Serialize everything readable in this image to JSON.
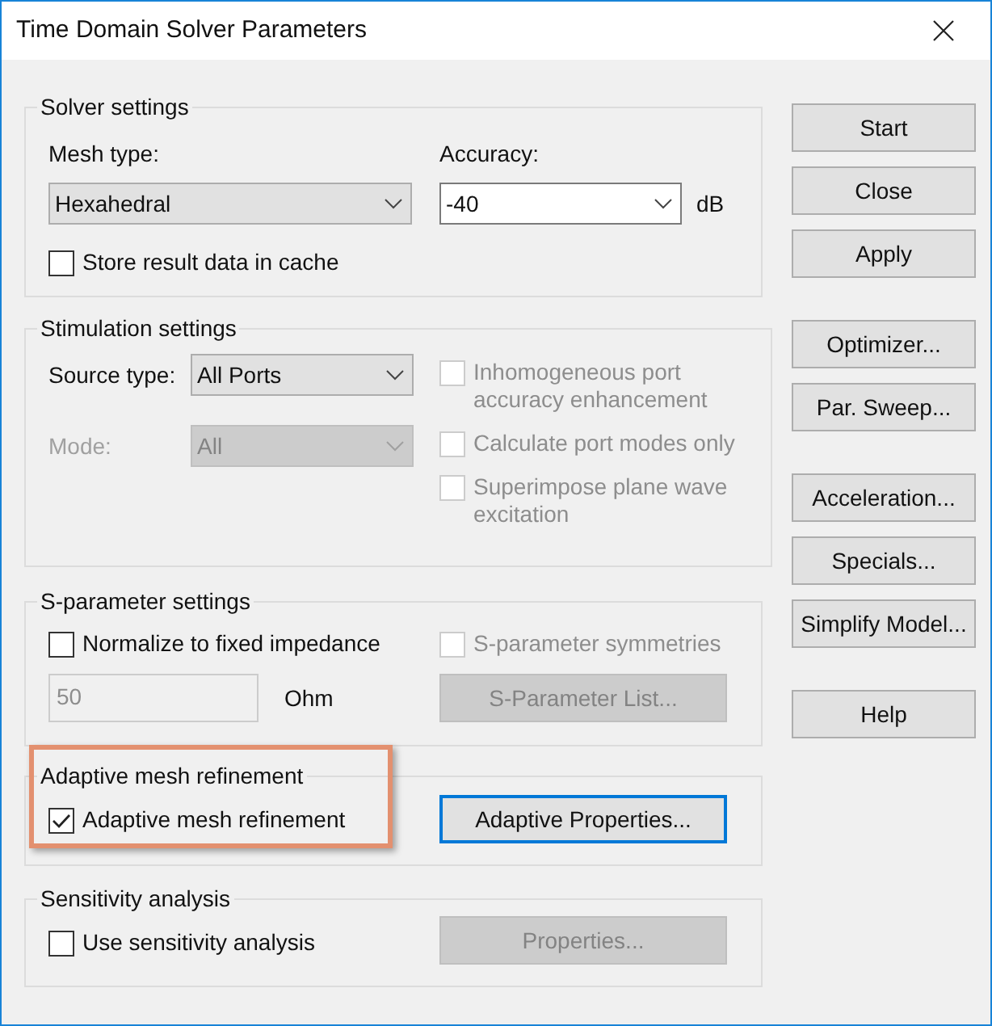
{
  "window": {
    "title": "Time Domain Solver Parameters"
  },
  "solver_settings": {
    "title": "Solver settings",
    "mesh_type": {
      "label": "Mesh type:",
      "value": "Hexahedral",
      "editable": false,
      "disabled": false
    },
    "accuracy": {
      "label": "Accuracy:",
      "value": "-40",
      "unit": "dB",
      "editable": true,
      "disabled": false
    },
    "store_cache": {
      "label": "Store result data in cache",
      "checked": false,
      "disabled": false
    }
  },
  "stimulation_settings": {
    "title": "Stimulation settings",
    "source_type": {
      "label": "Source type:",
      "value": "All Ports",
      "editable": false,
      "disabled": false
    },
    "mode": {
      "label": "Mode:",
      "value": "All",
      "disabled": true
    },
    "options": [
      {
        "label": "Inhomogeneous port accuracy enhancement",
        "checked": false,
        "disabled": true
      },
      {
        "label": "Calculate port modes only",
        "checked": false,
        "disabled": true
      },
      {
        "label": "Superimpose plane wave excitation",
        "checked": false,
        "disabled": true
      }
    ]
  },
  "s_parameter_settings": {
    "title": "S-parameter settings",
    "normalize": {
      "label": "Normalize to fixed impedance",
      "checked": false,
      "disabled": false
    },
    "symmetries": {
      "label": "S-parameter symmetries",
      "checked": false,
      "disabled": true
    },
    "impedance": {
      "value": "50",
      "unit": "Ohm",
      "disabled": true
    },
    "list_button": {
      "label": "S-Parameter List...",
      "disabled": true
    }
  },
  "adaptive_mesh_refinement": {
    "title": "Adaptive mesh refinement",
    "highlighted": true,
    "enable": {
      "label": "Adaptive mesh refinement",
      "checked": true,
      "disabled": false
    },
    "properties_button": {
      "label": "Adaptive Properties...",
      "disabled": false,
      "focused": true
    }
  },
  "sensitivity_analysis": {
    "title": "Sensitivity analysis",
    "enable": {
      "label": "Use sensitivity analysis",
      "checked": false,
      "disabled": false
    },
    "properties_button": {
      "label": "Properties...",
      "disabled": true
    }
  },
  "button_groups": [
    [
      {
        "label": "Start"
      },
      {
        "label": "Close"
      },
      {
        "label": "Apply"
      }
    ],
    [
      {
        "label": "Optimizer..."
      },
      {
        "label": "Par. Sweep..."
      }
    ],
    [
      {
        "label": "Acceleration..."
      },
      {
        "label": "Specials..."
      },
      {
        "label": "Simplify Model..."
      }
    ],
    [
      {
        "label": "Help"
      }
    ]
  ]
}
